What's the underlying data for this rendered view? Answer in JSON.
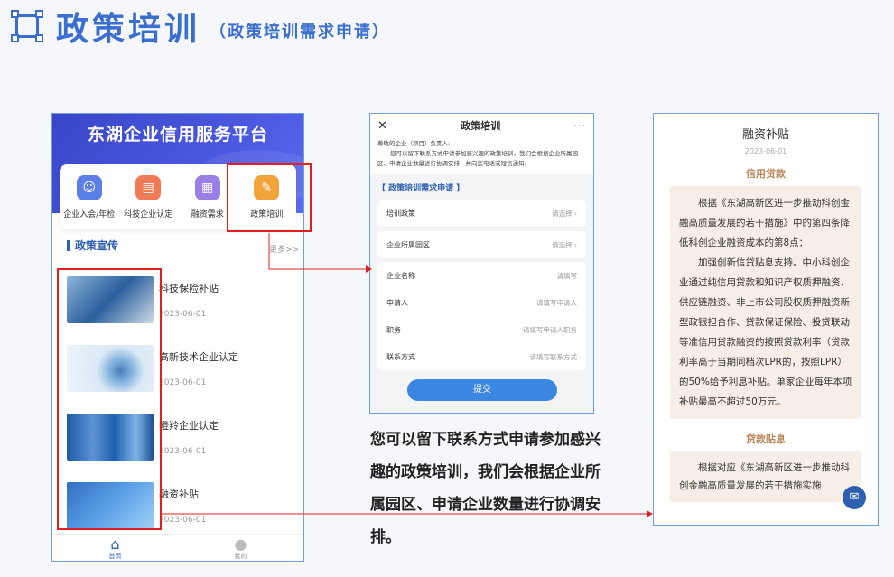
{
  "header": {
    "title": "政策培训",
    "subtitle": "（政策培训需求申请）"
  },
  "app": {
    "title": "东湖企业信用服务平台",
    "menu": [
      {
        "label": "企业入会/年检",
        "icon": "user-badge-icon",
        "color": "#5b7ee8",
        "glyph": "☺"
      },
      {
        "label": "科技企业认定",
        "icon": "briefcase-icon",
        "color": "#f07a55",
        "glyph": "▤"
      },
      {
        "label": "融资需求",
        "icon": "document-icon",
        "color": "#9a7fe6",
        "glyph": "▦"
      },
      {
        "label": "政策培训",
        "icon": "edit-doc-icon",
        "color": "#f2a33a",
        "glyph": "✎"
      }
    ],
    "section_title": "政策宣传",
    "more": "更多>>",
    "news": [
      {
        "title": "科技保险补贴",
        "date": "2023-06-01"
      },
      {
        "title": "高新技术企业认定",
        "date": "2023-06-01"
      },
      {
        "title": "瞪羚企业认定",
        "date": "2023-06-01"
      },
      {
        "title": "融资补贴",
        "date": "2023-06-01"
      }
    ],
    "tabs": [
      {
        "label": "首页",
        "icon": "home-icon"
      },
      {
        "label": "我的",
        "icon": "profile-icon"
      }
    ]
  },
  "form": {
    "nav_title": "政策培训",
    "close": "✕",
    "more": "···",
    "intro_line1": "尊敬的企业（项目）负责人:",
    "intro_line2": "您可以留下联系方式申请参加感兴趣的政策培训，我们会根据企业所属园区、申请企业数量进行协调安排，并向您电话或短信通知。",
    "section": "【 政策培训需求申请 】",
    "select_rows": [
      {
        "label": "培训政策",
        "value": "请选择"
      },
      {
        "label": "企业所属园区",
        "value": "请选择"
      }
    ],
    "input_rows": [
      {
        "label": "企业名称",
        "value": "请填写"
      },
      {
        "label": "申请人",
        "value": "请填写申请人"
      },
      {
        "label": "职务",
        "value": "请填写申请人职务"
      },
      {
        "label": "联系方式",
        "value": "请填写联系方式"
      }
    ],
    "submit": "提交"
  },
  "caption": "您可以留下联系方式申请参加感兴趣的政策培训，我们会根据企业所属园区、申请企业数量进行协调安排。",
  "detail": {
    "title": "融资补贴",
    "date": "2023-06-01",
    "section1": "信用贷款",
    "para1": "根据《东湖高新区进一步推动科创金融高质量发展的若干措施》中的第四条降低科创企业融资成本的第8点：",
    "para2": "加强创新信贷贴息支持。中小科创企业通过纯信用贷款和知识产权质押融资、供应链融资、非上市公司股权质押融资新型政银担合作、贷款保证保险、投贷联动等准信用贷款融资的按照贷款利率（贷款利率高于当期同档次LPR的，按照LPR）的50%给予利息补贴。单家企业每年本项补贴最高不超过50万元。",
    "section2": "贷款贴息",
    "para3": "根据对应《东湖高新区进一步推动科创金融高质量发展的若干措施实施"
  },
  "colors": {
    "accent": "#3a6fd0",
    "highlight": "#e02020"
  }
}
